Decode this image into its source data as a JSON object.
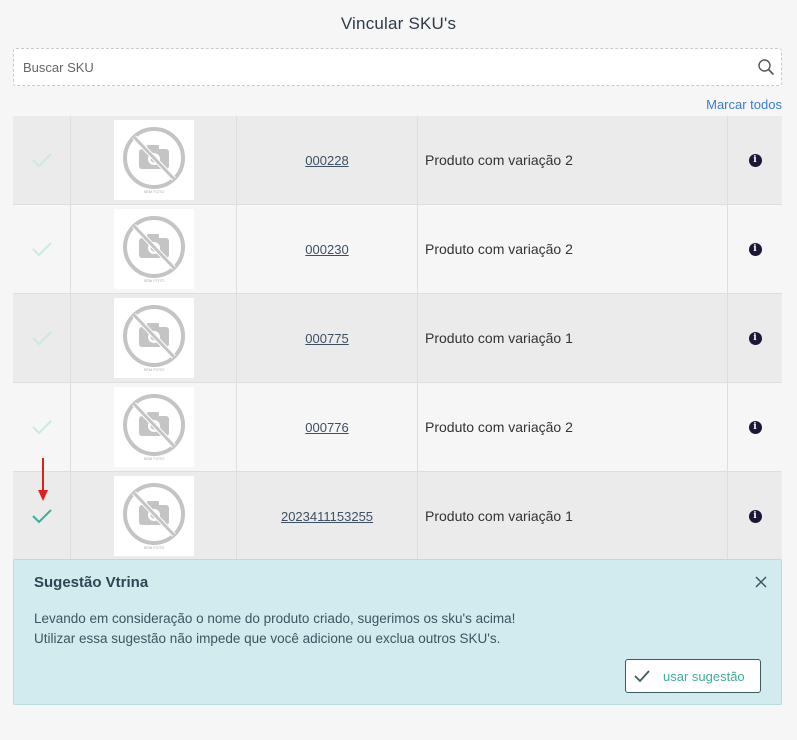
{
  "header": {
    "title": "Vincular SKU's"
  },
  "search": {
    "placeholder": "Buscar SKU",
    "value": ""
  },
  "actions": {
    "mark_all": "Marcar todos"
  },
  "colors": {
    "check_inactive": "#cce9e1",
    "check_active": "#3fae9b",
    "arrow": "#e01f1f",
    "info_bg": "#1c1637"
  },
  "rows": [
    {
      "code": "000228",
      "name": "Produto com variação 2",
      "selected": false,
      "thumb_label": "SEM FOTO"
    },
    {
      "code": "000230",
      "name": "Produto com variação 2",
      "selected": false,
      "thumb_label": "SEM FOTO"
    },
    {
      "code": "000775",
      "name": "Produto com variação 1",
      "selected": false,
      "thumb_label": "SEM FOTO"
    },
    {
      "code": "000776",
      "name": "Produto com variação 2",
      "selected": false,
      "thumb_label": "SEM FOTO"
    },
    {
      "code": "2023411153255",
      "name": "Produto com variação 1",
      "selected": true,
      "thumb_label": "SEM FOTO"
    }
  ],
  "suggestion": {
    "title": "Sugestão Vtrina",
    "line1": "Levando em consideração o nome do produto criado, sugerimos os sku's acima!",
    "line2": "Utilizar essa sugestão não impede que você adicione ou exclua outros SKU's.",
    "button": "usar sugestão"
  }
}
